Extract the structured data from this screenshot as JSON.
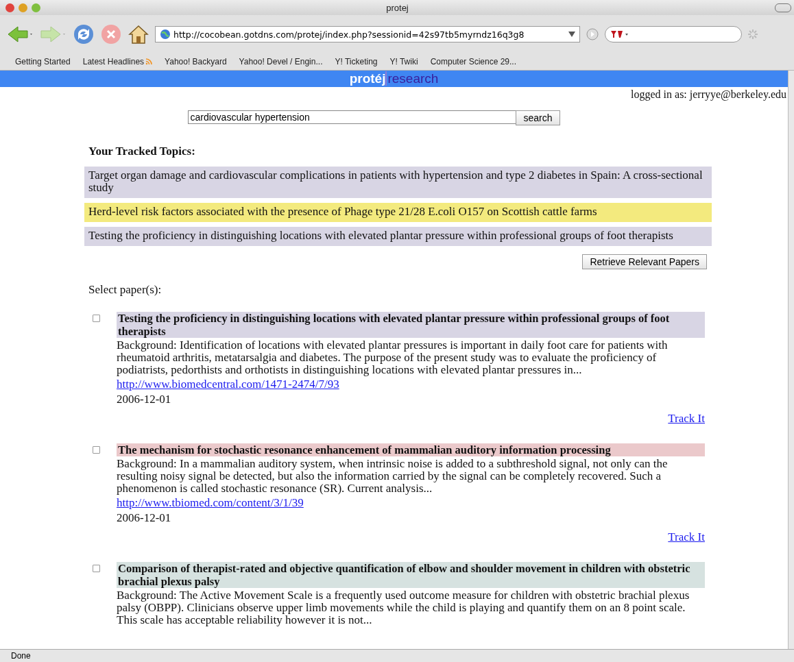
{
  "window": {
    "title": "protej"
  },
  "toolbar": {
    "url": "http://cocobean.gotdns.com/protej/index.php?sessionid=42s97tb5myrndz16q3g8"
  },
  "bookmarks": [
    "Getting Started",
    "Latest Headlines",
    "Yahoo! Backyard",
    "Yahoo! Devel / Engin...",
    "Y! Ticketing",
    "Y! Twiki",
    "Computer Science 29..."
  ],
  "banner": {
    "brand": "protéj",
    "suffix": "research"
  },
  "login": "logged in as: jerryye@berkeley.edu",
  "search": {
    "value": "cardiovascular hypertension",
    "button": "search"
  },
  "tracked_heading": "Your Tracked Topics:",
  "topics": [
    {
      "text": "Target organ damage and cardiovascular complications in patients with hypertension and type 2 diabetes in Spain: A cross-sectional study",
      "color": "#d8d5e4"
    },
    {
      "text": "Herd-level risk factors associated with the presence of Phage type 21/28 E.coli O157 on Scottish cattle farms",
      "color": "#f3ea7e"
    },
    {
      "text": "Testing the proficiency in distinguishing locations with elevated plantar pressure within professional groups of foot therapists",
      "color": "#d8d5e4"
    }
  ],
  "retrieve_button": "Retrieve Relevant Papers",
  "select_label": "Select paper(s):",
  "papers": [
    {
      "checked": false,
      "color": "#d8d5e4",
      "title": "Testing the proficiency in distinguishing locations with elevated plantar pressure within professional groups of foot therapists",
      "abstract": "Background: Identification of locations with elevated plantar pressures is important in daily foot care for patients with rheumatoid arthritis, metatarsalgia and diabetes. The purpose of the present study was to evaluate the proficiency of podiatrists, pedorthists and orthotists in distinguishing locations with elevated plantar pressures in...",
      "url": "http://www.biomedcentral.com/1471-2474/7/93",
      "date": "2006-12-01",
      "track": "Track It"
    },
    {
      "checked": false,
      "color": "#ebc9cb",
      "title": "The mechanism for stochastic resonance enhancement of mammalian auditory information processing",
      "abstract": "Background: In a mammalian auditory system, when intrinsic noise is added to a subthreshold signal, not only can the resulting noisy signal be detected, but also the information carried by the signal can be completely recovered. Such a phenomenon is called stochastic resonance (SR). Current analysis...",
      "url": "http://www.tbiomed.com/content/3/1/39",
      "date": "2006-12-01",
      "track": "Track It"
    },
    {
      "checked": false,
      "color": "#d6e2e0",
      "title": "Comparison of therapist-rated and objective quantification of elbow and shoulder movement in children with obstetric brachial plexus palsy",
      "abstract": "Background: The Active Movement Scale is a frequently used outcome measure for children with obstetric brachial plexus palsy (OBPP). Clinicians observe upper limb movements while the child is playing and quantify them on an 8 point scale. This scale has acceptable reliability however it is not..."
    }
  ],
  "status_bar": "Done"
}
